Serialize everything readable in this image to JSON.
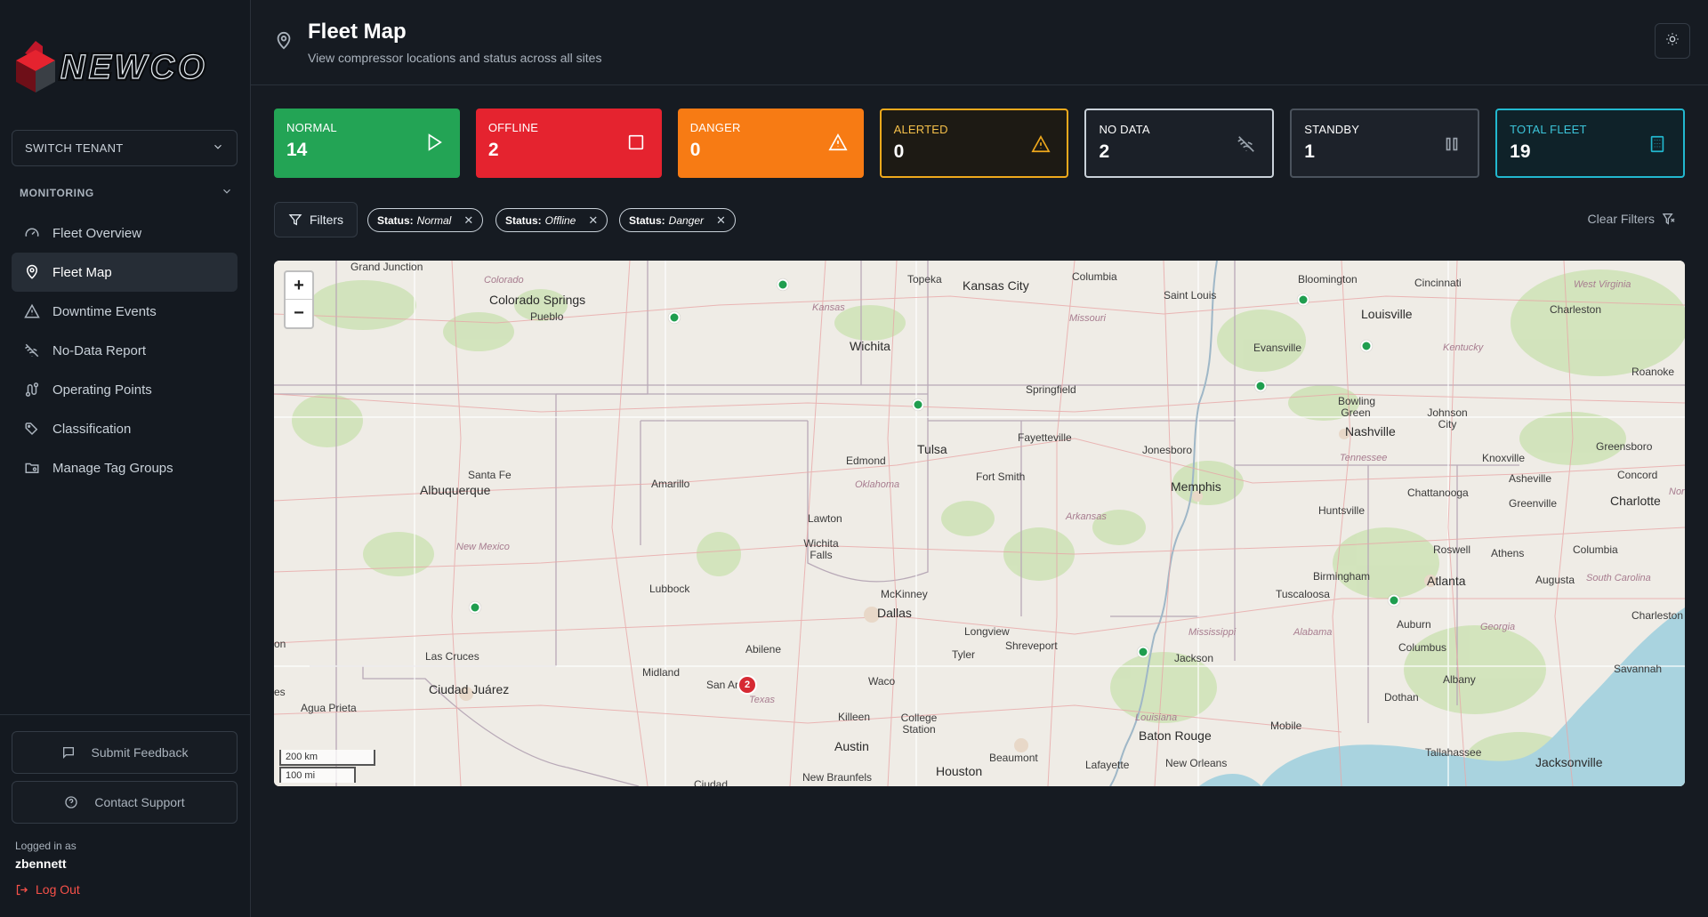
{
  "brand": {
    "name": "NEWCO",
    "accent": "#e5232f"
  },
  "sidebar": {
    "tenant_label": "SWITCH TENANT",
    "section_label": "MONITORING",
    "items": [
      {
        "label": "Fleet Overview",
        "icon": "gauge-icon"
      },
      {
        "label": "Fleet Map",
        "icon": "map-pin-icon",
        "active": true
      },
      {
        "label": "Downtime Events",
        "icon": "warning-icon"
      },
      {
        "label": "No-Data Report",
        "icon": "wifi-off-icon"
      },
      {
        "label": "Operating Points",
        "icon": "route-icon"
      },
      {
        "label": "Classification",
        "icon": "tags-icon"
      },
      {
        "label": "Manage Tag Groups",
        "icon": "folder-settings-icon"
      }
    ],
    "feedback_label": "Submit Feedback",
    "support_label": "Contact Support",
    "logged_in_label": "Logged in as",
    "username": "zbennett",
    "logout_label": "Log Out"
  },
  "header": {
    "title": "Fleet Map",
    "subtitle": "View compressor locations and status across all sites"
  },
  "stats": [
    {
      "label": "NORMAL",
      "value": "14",
      "color": "#23a455"
    },
    {
      "label": "OFFLINE",
      "value": "2",
      "color": "#e5232f"
    },
    {
      "label": "DANGER",
      "value": "0",
      "color": "#f77b14"
    },
    {
      "label": "ALERTED",
      "value": "0",
      "color": "#f0a91c"
    },
    {
      "label": "NO DATA",
      "value": "2",
      "color": "#c9d1d9"
    },
    {
      "label": "STANDBY",
      "value": "1",
      "color": "#4b535d"
    },
    {
      "label": "TOTAL FLEET",
      "value": "19",
      "color": "#22b8cf"
    }
  ],
  "filters": {
    "button_label": "Filters",
    "chips": [
      {
        "key": "Status:",
        "value": "Normal"
      },
      {
        "key": "Status:",
        "value": "Offline"
      },
      {
        "key": "Status:",
        "value": "Danger"
      }
    ],
    "clear_label": "Clear Filters"
  },
  "map": {
    "zoom_in": "+",
    "zoom_out": "−",
    "scale_km": "200 km",
    "scale_mi": "100 mi",
    "cluster_count": "2",
    "labels": {
      "grand_junction": "Grand Junction",
      "colorado": "Colorado",
      "colorado_springs": "Colorado Springs",
      "pueblo": "Pueblo",
      "kansas": "Kansas",
      "topeka": "Topeka",
      "kansas_city": "Kansas City",
      "columbia": "Columbia",
      "saint_louis": "Saint Louis",
      "bloomington": "Bloomington",
      "cincinnati": "Cincinnati",
      "west_virginia": "West Virginia",
      "charleston_wv": "Charleston",
      "louisville": "Louisville",
      "missouri": "Missouri",
      "wichita": "Wichita",
      "evansville": "Evansville",
      "kentucky": "Kentucky",
      "roanoke": "Roanoke",
      "springfield": "Springfield",
      "bowling_green": "Bowling Green",
      "johnson_city": "Johnson City",
      "nashville": "Nashville",
      "greensboro": "Greensboro",
      "fayetteville": "Fayetteville",
      "tulsa": "Tulsa",
      "jonesboro": "Jonesboro",
      "tennessee": "Tennessee",
      "knoxville": "Knoxville",
      "santa_fe": "Santa Fe",
      "albuquerque": "Albuquerque",
      "amarillo": "Amarillo",
      "edmond": "Edmond",
      "oklahoma": "Oklahoma",
      "fort_smith": "Fort Smith",
      "memphis": "Memphis",
      "asheville": "Asheville",
      "concord": "Concord",
      "charlotte": "Charlotte",
      "chattanooga": "Chattanooga",
      "nor": "Nor",
      "huntsville": "Huntsville",
      "greenville": "Greenville",
      "lawton": "Lawton",
      "arkansas": "Arkansas",
      "new_mexico": "New Mexico",
      "wichita_falls": "Wichita Falls",
      "roswell": "Roswell",
      "athens": "Athens",
      "columbia_sc": "Columbia",
      "birmingham": "Birmingham",
      "lubbock": "Lubbock",
      "augusta": "Augusta",
      "south_carolina": "South Carolina",
      "tuscaloosa": "Tuscaloosa",
      "atlanta": "Atlanta",
      "mckinney": "McKinney",
      "dallas": "Dallas",
      "mississippi": "Mississippi",
      "charleston_sc": "Charleston",
      "longview": "Longview",
      "alabama": "Alabama",
      "georgia": "Georgia",
      "auburn": "Auburn",
      "shreveport": "Shreveport",
      "tyler": "Tyler",
      "abilene": "Abilene",
      "las_cruces": "Las Cruces",
      "jackson": "Jackson",
      "columbus": "Columbus",
      "on": "on",
      "es": "es",
      "midland": "Midland",
      "savannah": "Savannah",
      "ciudad_juarez": "Ciudad Juárez",
      "san_angelo": "San Ar",
      "waco": "Waco",
      "albany": "Albany",
      "agua_prieta": "Agua Prieta",
      "texas": "Texas",
      "dothan": "Dothan",
      "killeen": "Killeen",
      "college_station": "College Station",
      "louisiana": "Louisiana",
      "mobile": "Mobile",
      "baton_rouge": "Baton Rouge",
      "austin": "Austin",
      "tallahassee": "Tallahassee",
      "beaumont": "Beaumont",
      "jacksonville": "Jacksonville",
      "lafayette": "Lafayette",
      "new_orleans": "New Orleans",
      "new_braunfels": "New Braunfels",
      "houston": "Houston",
      "ciudad": "Ciudad"
    }
  }
}
